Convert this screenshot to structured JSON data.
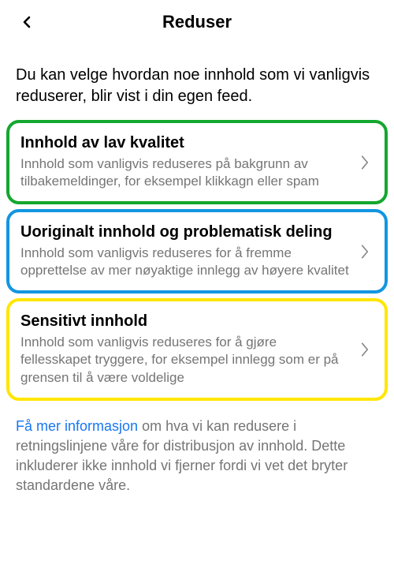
{
  "header": {
    "title": "Reduser"
  },
  "intro": "Du kan velge hvordan noe innhold som vi vanligvis reduserer, blir vist i din egen feed.",
  "items": [
    {
      "title": "Innhold av lav kvalitet",
      "desc": "Innhold som vanligvis reduseres på bakgrunn av tilbakemeldinger, for eksempel klikkagn eller spam"
    },
    {
      "title": "Uoriginalt innhold og problematisk deling",
      "desc": "Innhold som vanligvis reduseres for å fremme opprettelse av mer nøyaktige innlegg av høyere kvalitet"
    },
    {
      "title": "Sensitivt innhold",
      "desc": "Innhold som vanligvis reduseres for å gjøre fellesskapet tryggere, for eksempel innlegg som er på grensen til å være voldelige"
    }
  ],
  "footer": {
    "link": "Få mer informasjon",
    "rest": " om hva vi kan redusere i retningslinjene våre for distribusjon av innhold. Dette inkluderer ikke innhold vi fjerner fordi vi vet det bryter standardene våre."
  }
}
